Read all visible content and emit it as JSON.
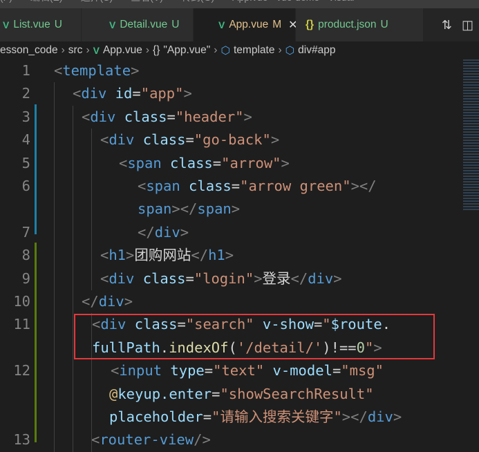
{
  "menubar": [
    "(F)",
    "编辑(E)",
    "选择(S)",
    "查看(V)",
    "转到(G)",
    "App.vue - vue-demo - Visual"
  ],
  "tabs": [
    {
      "name": "List.vue",
      "status": "U",
      "icon": "vue-icon",
      "active": false
    },
    {
      "name": "Detail.vue",
      "status": "U",
      "icon": "vue-icon",
      "active": false
    },
    {
      "name": "App.vue",
      "status": "M",
      "icon": "vue-icon",
      "active": true
    },
    {
      "name": "product.json",
      "status": "U",
      "icon": "json-braces-icon",
      "active": false
    }
  ],
  "close_glyph": "✕",
  "breadcrumb": [
    "esson_code",
    "src",
    "App.vue",
    "\"App.vue\"",
    "template",
    "div#app"
  ],
  "colors": {
    "tag": "#569cd6",
    "attr": "#9cdcfe",
    "string": "#ce9178",
    "highlight_box": "#e5383b",
    "git_modified": "#1b81a8",
    "git_added": "#587c0c"
  },
  "lines": [
    {
      "n": "1",
      "indent": 78,
      "tokens": [
        [
          "<",
          "br"
        ],
        [
          "template",
          "tag"
        ],
        [
          ">",
          "br"
        ]
      ]
    },
    {
      "n": "2",
      "indent": 105,
      "tokens": [
        [
          "<",
          "br"
        ],
        [
          "div",
          "tag"
        ],
        [
          " id",
          "attr"
        ],
        [
          "=",
          "txt"
        ],
        [
          "\"app\"",
          "str"
        ],
        [
          ">",
          "br"
        ]
      ]
    },
    {
      "n": "3",
      "indent": 118,
      "tokens": [
        [
          "<",
          "br"
        ],
        [
          "div",
          "tag"
        ],
        [
          " class",
          "attr"
        ],
        [
          "=",
          "txt"
        ],
        [
          "\"header\"",
          "str"
        ],
        [
          ">",
          "br"
        ]
      ]
    },
    {
      "n": "4",
      "indent": 145,
      "tokens": [
        [
          "<",
          "br"
        ],
        [
          "div",
          "tag"
        ],
        [
          " class",
          "attr"
        ],
        [
          "=",
          "txt"
        ],
        [
          "\"go-back\"",
          "str"
        ],
        [
          ">",
          "br"
        ]
      ]
    },
    {
      "n": "5",
      "indent": 172,
      "tokens": [
        [
          "<",
          "br"
        ],
        [
          "span",
          "tag"
        ],
        [
          " class",
          "attr"
        ],
        [
          "=",
          "txt"
        ],
        [
          "\"arrow\"",
          "str"
        ],
        [
          ">",
          "br"
        ]
      ]
    },
    {
      "n": "6",
      "indent": 199,
      "tokens": [
        [
          "<",
          "br"
        ],
        [
          "span",
          "tag"
        ],
        [
          " class",
          "attr"
        ],
        [
          "=",
          "txt"
        ],
        [
          "\"arrow green\"",
          "str"
        ],
        [
          "></",
          "br"
        ]
      ]
    },
    {
      "n": "",
      "indent": 199,
      "tokens": [
        [
          "span",
          "tag"
        ],
        [
          "></",
          "br"
        ],
        [
          "span",
          "tag"
        ],
        [
          ">",
          "br"
        ]
      ]
    },
    {
      "n": "7",
      "indent": 199,
      "tokens": [
        [
          "</",
          "br"
        ],
        [
          "div",
          "tag"
        ],
        [
          ">",
          "br"
        ]
      ]
    },
    {
      "n": "8",
      "indent": 145,
      "tokens": [
        [
          "<",
          "br"
        ],
        [
          "h1",
          "tag"
        ],
        [
          ">",
          "br"
        ],
        [
          "团购网站",
          "txt"
        ],
        [
          "</",
          "br"
        ],
        [
          "h1",
          "tag"
        ],
        [
          ">",
          "br"
        ]
      ]
    },
    {
      "n": "9",
      "indent": 145,
      "tokens": [
        [
          "<",
          "br"
        ],
        [
          "div",
          "tag"
        ],
        [
          " class",
          "attr"
        ],
        [
          "=",
          "txt"
        ],
        [
          "\"login\"",
          "str"
        ],
        [
          ">",
          "br"
        ],
        [
          "登录",
          "txt"
        ],
        [
          "</",
          "br"
        ],
        [
          "div",
          "tag"
        ],
        [
          ">",
          "br"
        ]
      ]
    },
    {
      "n": "10",
      "indent": 118,
      "tokens": [
        [
          "</",
          "br"
        ],
        [
          "div",
          "tag"
        ],
        [
          ">",
          "br"
        ]
      ]
    },
    {
      "n": "11",
      "indent": 133,
      "tokens": [
        [
          "<",
          "br"
        ],
        [
          "div",
          "tag"
        ],
        [
          " class",
          "attr"
        ],
        [
          "=",
          "txt"
        ],
        [
          "\"search\"",
          "str"
        ],
        [
          " v-show",
          "attr"
        ],
        [
          "=",
          "txt"
        ],
        [
          "\"",
          "str"
        ],
        [
          "$route",
          "var"
        ],
        [
          ".",
          "txt"
        ]
      ]
    },
    {
      "n": "",
      "indent": 133,
      "tokens": [
        [
          "fullPath",
          "var"
        ],
        [
          ".",
          "txt"
        ],
        [
          "indexOf",
          "fn"
        ],
        [
          "(",
          "txt"
        ],
        [
          "'/detail/'",
          "str"
        ],
        [
          ")!==",
          "txt"
        ],
        [
          "0",
          "num"
        ],
        [
          "\"",
          "str"
        ],
        [
          ">",
          "br"
        ]
      ]
    },
    {
      "n": "12",
      "indent": 160,
      "tokens": [
        [
          "<",
          "br"
        ],
        [
          "input",
          "tag"
        ],
        [
          " type",
          "attr"
        ],
        [
          "=",
          "txt"
        ],
        [
          "\"text\"",
          "str"
        ],
        [
          " v-model",
          "attr"
        ],
        [
          "=",
          "txt"
        ],
        [
          "\"msg\"",
          "str"
        ]
      ]
    },
    {
      "n": "",
      "indent": 158,
      "tokens": [
        [
          "@",
          "at"
        ],
        [
          "keyup.enter",
          "attr"
        ],
        [
          "=",
          "txt"
        ],
        [
          "\"showSearchResult\"",
          "str"
        ]
      ]
    },
    {
      "n": "",
      "indent": 158,
      "tokens": [
        [
          "placeholder",
          "attr"
        ],
        [
          "=",
          "txt"
        ],
        [
          "\"请输入搜索关键字\"",
          "str"
        ],
        [
          "></",
          "br"
        ],
        [
          "div",
          "tag"
        ],
        [
          ">",
          "br"
        ]
      ]
    },
    {
      "n": "13",
      "indent": 132,
      "tokens": [
        [
          "<",
          "br"
        ],
        [
          "router-view",
          "tag"
        ],
        [
          "/>",
          "br"
        ]
      ]
    }
  ]
}
